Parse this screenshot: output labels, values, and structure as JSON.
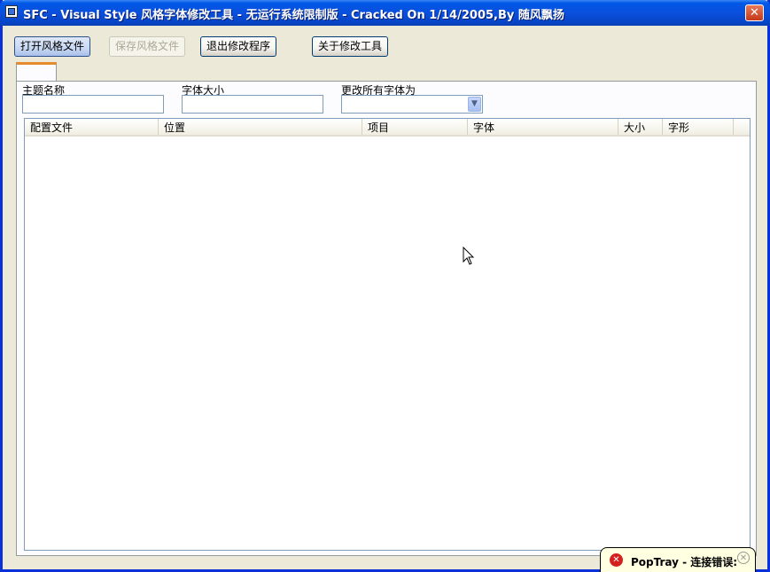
{
  "window": {
    "title": "SFC - Visual Style 风格字体修改工具 - 无运行系统限制版 - Cracked On 1/14/2005,By 随风飘扬",
    "close_glyph": "✕"
  },
  "toolbar": {
    "open_label": "打开风格文件",
    "save_label": "保存风格文件",
    "exit_label": "退出修改程序",
    "about_label": "关于修改工具"
  },
  "form": {
    "theme_name_label": "主题名称",
    "theme_name_value": "",
    "font_size_label": "字体大小",
    "font_size_value": "",
    "change_all_label": "更改所有字体为",
    "change_all_value": ""
  },
  "table": {
    "columns": [
      "配置文件",
      "位置",
      "项目",
      "字体",
      "大小",
      "字形"
    ],
    "rows": []
  },
  "notification": {
    "text": "PopTray - 连接错误:",
    "icon": "error-icon",
    "close_glyph": "✕",
    "error_glyph": "✕"
  },
  "colors": {
    "titlebar": "#0a4fdd",
    "window_bg": "#ece9d8",
    "tab_accent": "#e68b2c",
    "error_red": "#d4211f",
    "tooltip_bg": "#ffffe1"
  }
}
